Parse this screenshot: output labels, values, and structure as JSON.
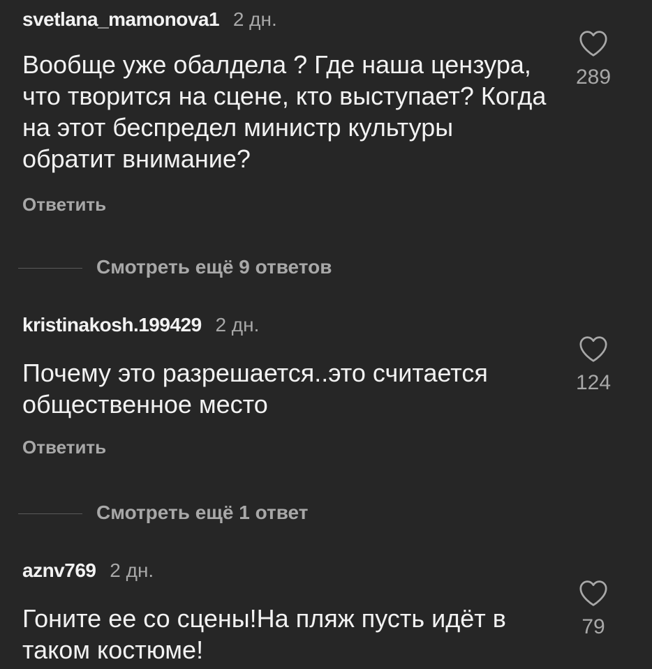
{
  "comments": [
    {
      "username": "svetlana_mamonova1",
      "time": "2 дн.",
      "text": "Вообще уже обалдела ? Где наша цензура, что творится на сцене, кто выступает? Когда на этот беспредел министр культуры обратит внимание?",
      "likes": "289",
      "reply_label": "Ответить",
      "more_replies": "Смотреть ещё 9 ответов"
    },
    {
      "username": "kristinakosh.199429",
      "time": "2 дн.",
      "text": "Почему это разрешается..это считается общественное место",
      "likes": "124",
      "reply_label": "Ответить",
      "more_replies": "Смотреть ещё 1 ответ"
    },
    {
      "username": "aznv769",
      "time": "2 дн.",
      "text": "Гоните ее со сцены!На пляж пусть идёт в таком костюме!",
      "likes": "79"
    }
  ],
  "icons": {
    "like": "heart-outline-icon"
  },
  "colors": {
    "background": "#262626",
    "primary_text": "#f2f2f2",
    "secondary_text": "#a8a8a8",
    "divider": "#5a5a5a"
  }
}
